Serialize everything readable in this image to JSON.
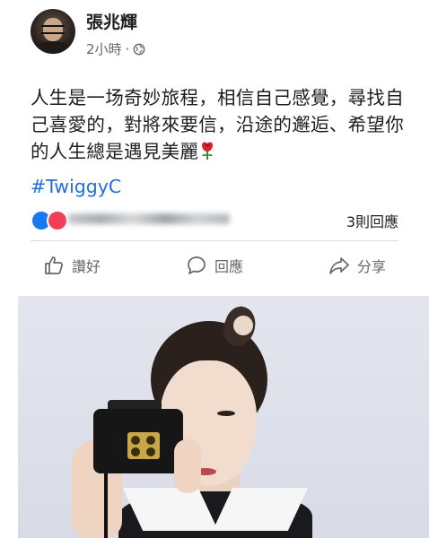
{
  "post": {
    "author": "張兆輝",
    "time": "2小時",
    "separator": "·",
    "privacy_icon": "globe-icon",
    "text": "人生是一场奇妙旅程，相信自己感覺，尋找自己喜愛的，對將來要信，沿途的邂逅、希望你的人生總是遇見美麗",
    "emoji": "rose-icon",
    "hashtag": "#TwiggyC"
  },
  "stats": {
    "reaction_icons": [
      "like-icon",
      "love-icon"
    ],
    "comments": "3則回應"
  },
  "actions": [
    {
      "label": "讚好",
      "icon": "thumbs-up-icon"
    },
    {
      "label": "回應",
      "icon": "comment-icon"
    },
    {
      "label": "分享",
      "icon": "share-icon"
    }
  ],
  "colors": {
    "link": "#216fdb",
    "secondary_text": "#65676b",
    "like_blue": "#1877f2",
    "love_red": "#f33e58"
  }
}
